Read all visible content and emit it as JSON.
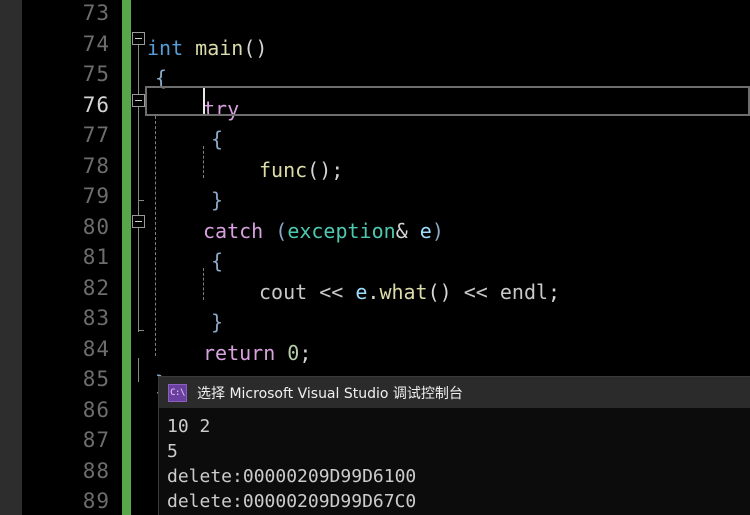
{
  "editor": {
    "theme_background": "#000000",
    "gutter_background": "#000000",
    "change_bar_color": "#57a64a",
    "current_line": 76,
    "line_numbers": [
      73,
      74,
      75,
      76,
      77,
      78,
      79,
      80,
      81,
      82,
      83,
      84,
      85,
      86,
      87,
      88,
      89
    ],
    "lines": [
      {
        "number": 73,
        "segments": []
      },
      {
        "number": 74,
        "segments": [
          {
            "text": "int",
            "kind": "keyword"
          },
          {
            "text": " ",
            "kind": "plain"
          },
          {
            "text": "main",
            "kind": "function"
          },
          {
            "text": "()",
            "kind": "punct"
          }
        ]
      },
      {
        "number": 75,
        "segments": [
          {
            "text": "{",
            "kind": "brace"
          }
        ]
      },
      {
        "number": 76,
        "segments": [
          {
            "text": "try",
            "kind": "control"
          }
        ]
      },
      {
        "number": 77,
        "segments": [
          {
            "text": "{",
            "kind": "brace"
          }
        ]
      },
      {
        "number": 78,
        "segments": [
          {
            "text": "func",
            "kind": "function"
          },
          {
            "text": "();",
            "kind": "punct"
          }
        ]
      },
      {
        "number": 79,
        "segments": [
          {
            "text": "}",
            "kind": "brace"
          }
        ]
      },
      {
        "number": 80,
        "segments": [
          {
            "text": "catch",
            "kind": "control"
          },
          {
            "text": " ",
            "kind": "plain"
          },
          {
            "text": "(",
            "kind": "brace"
          },
          {
            "text": "exception",
            "kind": "type"
          },
          {
            "text": "&",
            "kind": "punct"
          },
          {
            "text": " ",
            "kind": "plain"
          },
          {
            "text": "e",
            "kind": "variable"
          },
          {
            "text": ")",
            "kind": "brace"
          }
        ]
      },
      {
        "number": 81,
        "segments": [
          {
            "text": "{",
            "kind": "brace"
          }
        ]
      },
      {
        "number": 82,
        "segments": [
          {
            "text": "cout",
            "kind": "stream"
          },
          {
            "text": " << ",
            "kind": "stream"
          },
          {
            "text": "e",
            "kind": "variable"
          },
          {
            "text": ".",
            "kind": "punct"
          },
          {
            "text": "what",
            "kind": "function"
          },
          {
            "text": "()",
            "kind": "punct"
          },
          {
            "text": " << ",
            "kind": "stream"
          },
          {
            "text": "endl",
            "kind": "stream"
          },
          {
            "text": ";",
            "kind": "punct"
          }
        ]
      },
      {
        "number": 83,
        "segments": [
          {
            "text": "}",
            "kind": "brace"
          }
        ]
      },
      {
        "number": 84,
        "segments": [
          {
            "text": "return",
            "kind": "control"
          },
          {
            "text": " ",
            "kind": "plain"
          },
          {
            "text": "0",
            "kind": "number"
          },
          {
            "text": ";",
            "kind": "punct"
          }
        ]
      },
      {
        "number": 85,
        "segments": [
          {
            "text": "}",
            "kind": "brace"
          }
        ]
      }
    ],
    "fold_markers": [
      {
        "line": 74,
        "state": "expanded",
        "glyph": "minus-box"
      },
      {
        "line": 76,
        "state": "expanded",
        "glyph": "minus-box"
      },
      {
        "line": 80,
        "state": "expanded",
        "glyph": "minus-box"
      }
    ]
  },
  "console": {
    "icon_label": "C:\\",
    "icon_name": "console-app-icon",
    "title": "选择 Microsoft Visual Studio 调试控制台",
    "background": "#0c0c0c",
    "titlebar_background": "#2b2b2b",
    "output_lines": [
      "10 2",
      "5",
      "delete:00000209D99D6100",
      "delete:00000209D99D67C0"
    ]
  }
}
